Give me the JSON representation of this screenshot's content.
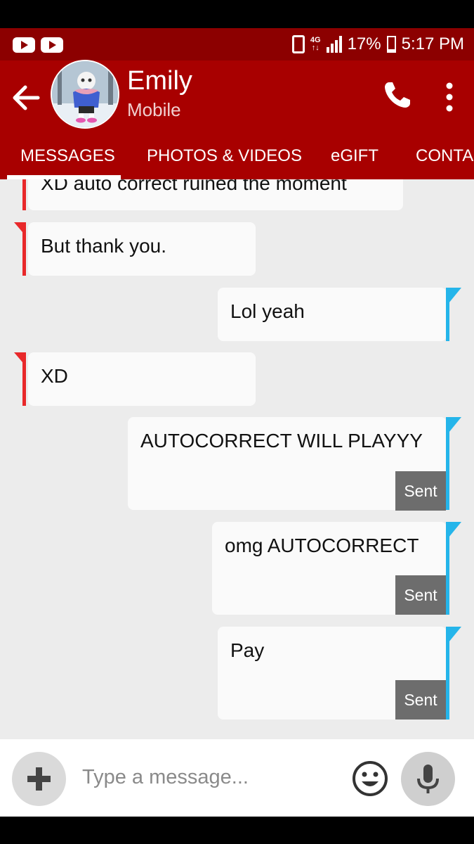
{
  "status_bar": {
    "network": "4G",
    "battery_percent_label": "17%",
    "battery_level": 0.17,
    "signal_bars": 4,
    "time": "5:17 PM",
    "notification_icons": [
      "youtube-icon",
      "youtube-icon"
    ]
  },
  "header": {
    "contact_name": "Emily",
    "contact_type": "Mobile",
    "icons": [
      "back-arrow-icon",
      "avatar",
      "phone-icon",
      "more-vertical-icon"
    ]
  },
  "tabs": [
    {
      "label": "MESSAGES",
      "active": true
    },
    {
      "label": "PHOTOS & VIDEOS",
      "active": false
    },
    {
      "label": "eGIFT",
      "active": false
    },
    {
      "label": "CONTACT",
      "active": false
    }
  ],
  "messages": [
    {
      "direction": "incoming",
      "text": "XD auto correct ruined the moment",
      "status": ""
    },
    {
      "direction": "incoming",
      "text": "But thank you.",
      "status": ""
    },
    {
      "direction": "outgoing",
      "text": "Lol yeah",
      "status": ""
    },
    {
      "direction": "incoming",
      "text": "XD",
      "status": ""
    },
    {
      "direction": "outgoing",
      "text": "AUTOCORRECT WILL PLAYYY",
      "status": "Sent"
    },
    {
      "direction": "outgoing",
      "text": "omg AUTOCORRECT",
      "status": "Sent"
    },
    {
      "direction": "outgoing",
      "text": "Pay",
      "status": "Sent"
    }
  ],
  "composer": {
    "placeholder": "Type a message...",
    "icons": [
      "plus-icon",
      "emoji-icon",
      "microphone-icon"
    ]
  },
  "colors": {
    "status_bar_bg": "#8c0000",
    "app_bar_bg": "#a80000",
    "incoming_accent": "#e8282a",
    "outgoing_accent": "#25b5ea",
    "chat_bg": "#ececec",
    "sent_badge_bg": "#6d6d6d"
  }
}
